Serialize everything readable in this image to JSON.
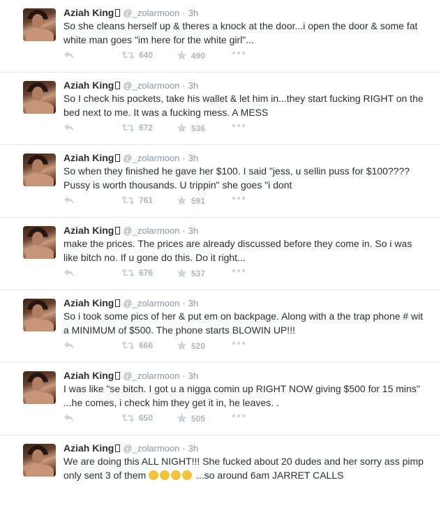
{
  "tweets": [
    {
      "name": "Aziah King",
      "handle": "@_zolarmoon",
      "dot": "·",
      "time": "3h",
      "text": "So she cleans herself up & theres a knock at the door...i open the door & some fat white man goes \"im here for the white girl\"...",
      "retweets": "640",
      "favorites": "490"
    },
    {
      "name": "Aziah King",
      "handle": "@_zolarmoon",
      "dot": "·",
      "time": "3h",
      "text": "So I check his pockets, take his wallet & let him in...they start fucking RIGHT on the bed next to me. It was a fucking mess. A MESS",
      "retweets": "672",
      "favorites": "536"
    },
    {
      "name": "Aziah King",
      "handle": "@_zolarmoon",
      "dot": "·",
      "time": "3h",
      "text": "So when they finished he gave her $100. I said \"jess, u sellin puss for $100???? Pussy is worth thousands. U trippin\" she goes \"i dont",
      "retweets": "761",
      "favorites": "591"
    },
    {
      "name": "Aziah King",
      "handle": "@_zolarmoon",
      "dot": "·",
      "time": "3h",
      "text": "make the prices. The prices are already discussed before they come in. So i was like bitch no. If u gone do this. Do it right...",
      "retweets": "676",
      "favorites": "537"
    },
    {
      "name": "Aziah King",
      "handle": "@_zolarmoon",
      "dot": "·",
      "time": "3h",
      "text": "So i took some pics of her & put em on backpage. Along with a the trap phone # wit a MINIMUM of $500.  The phone starts BLOWIN UP!!!",
      "retweets": "666",
      "favorites": "520"
    },
    {
      "name": "Aziah King",
      "handle": "@_zolarmoon",
      "dot": "·",
      "time": "3h",
      "text": "I was like \"se bitch. I got u a nigga comin up RIGHT NOW giving $500 for 15 mins\" ...he comes, i check him they get it in, he leaves. .",
      "retweets": "650",
      "favorites": "505"
    },
    {
      "name": "Aziah King",
      "handle": "@_zolarmoon",
      "dot": "·",
      "time": "3h",
      "text_before_emoji": "We are doing this ALL NIGHT!!! She fucked about 20 dudes and her sorry ass pimp only sent 3 of them",
      "emoji_icons": [
        "unamused-face-icon",
        "unamused-face-icon",
        "unamused-face-icon",
        "unamused-face-icon"
      ],
      "text_after_emoji": " ...so around 6am JARRET CALLS"
    }
  ],
  "colors": {
    "text": "#292f33",
    "muted": "#8899a6",
    "action": "#aab8c2",
    "divider": "#e1e8ed"
  }
}
